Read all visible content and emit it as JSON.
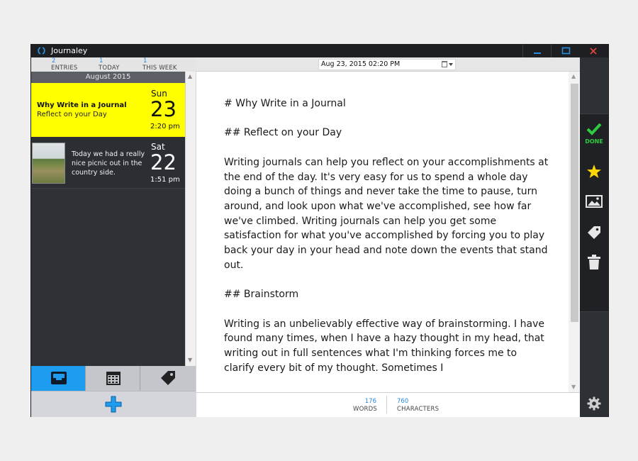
{
  "window": {
    "title": "Journaley"
  },
  "stats": [
    {
      "value": "2",
      "label": "ENTRIES"
    },
    {
      "value": "1",
      "label": "TODAY"
    },
    {
      "value": "1",
      "label": "THIS WEEK"
    }
  ],
  "list": {
    "month": "August 2015",
    "entries": [
      {
        "title": "Why Write in a Journal",
        "subtitle": "Reflect on your Day",
        "dow": "Sun",
        "day": "23",
        "time": "2:20 pm"
      },
      {
        "snippet": "Today we had a really nice picnic out in the country side.",
        "dow": "Sat",
        "day": "22",
        "time": "1:51 pm"
      }
    ]
  },
  "editor": {
    "date": "Aug 23, 2015 02:20 PM",
    "content": "# Why Write in a Journal\n\n## Reflect on your Day\n\nWriting journals can help you reflect on your accomplishments at the end of the day. It's very easy for us to spend a whole day doing a bunch of things and never take the time to pause, turn around, and look upon what we've accomplished, see how far we've climbed. Writing journals can help you get some satisfaction for what you've accomplished by forcing you to play back your day in your head and note down the events that stand out.\n\n## Brainstorm\n\nWriting is an unbelievably effective way of brainstorming. I have found many times, when I have a hazy thought in my head, that writing out in full sentences what I'm thinking forces me to clarify every bit of my thought. Sometimes I",
    "words": {
      "value": "176",
      "label": "WORDS"
    },
    "characters": {
      "value": "760",
      "label": "CHARACTERS"
    }
  },
  "toolbar": {
    "done_label": "DONE"
  },
  "colors": {
    "accent": "#1e9cf0",
    "selected_entry": "#ffff00",
    "done": "#2ecc40",
    "star": "#ffd700"
  }
}
